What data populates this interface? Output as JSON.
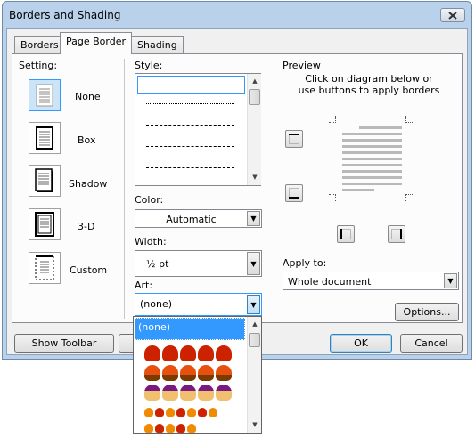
{
  "window": {
    "title": "Borders and Shading"
  },
  "tabs": [
    "Borders",
    "Page Border",
    "Shading"
  ],
  "setting": {
    "label": "Setting:",
    "items": [
      "None",
      "Box",
      "Shadow",
      "3-D",
      "Custom"
    ]
  },
  "style": {
    "label": "Style:"
  },
  "color": {
    "label": "Color:",
    "value": "Automatic"
  },
  "width": {
    "label": "Width:",
    "value": "½ pt"
  },
  "art": {
    "label": "Art:",
    "value": "(none)",
    "options": [
      "(none)"
    ]
  },
  "preview": {
    "label": "Preview",
    "hint": "Click on diagram below or use buttons to apply borders"
  },
  "apply_to": {
    "label": "Apply to:",
    "value": "Whole document"
  },
  "buttons": {
    "options": "Options...",
    "show_toolbar": "Show Toolbar",
    "ok": "OK",
    "cancel": "Cancel"
  },
  "colors": {
    "frame": "#b9d1ea",
    "selection": "#3399ff",
    "art_red": "#cc2200",
    "art_orange": "#f08a00"
  }
}
